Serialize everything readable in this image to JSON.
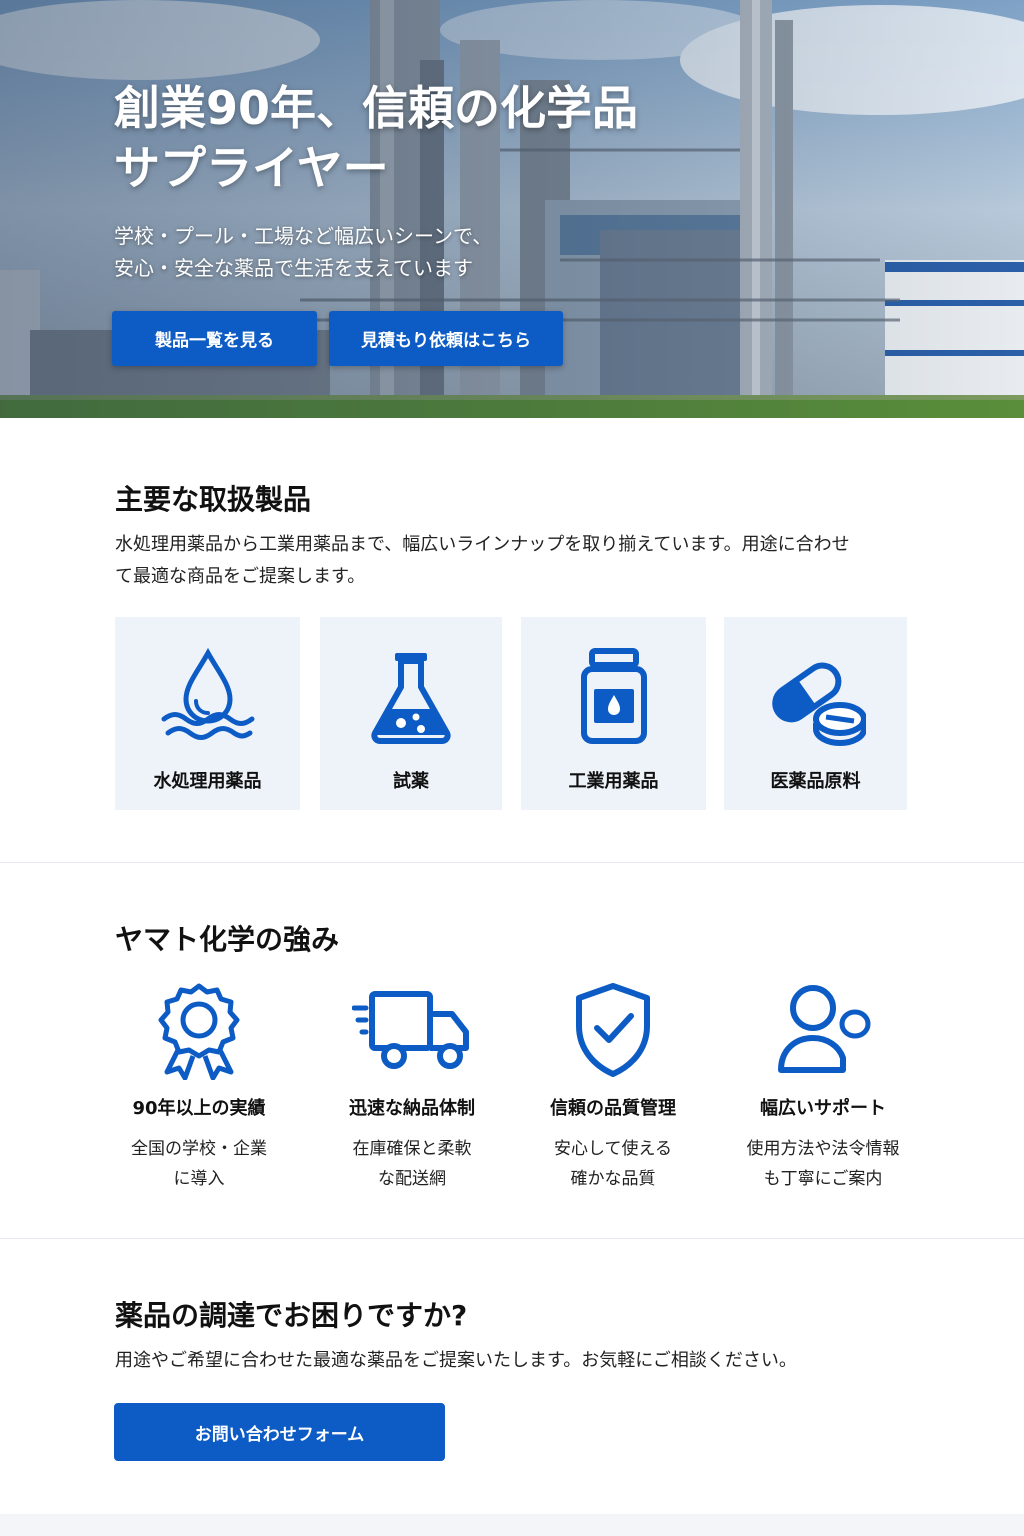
{
  "hero": {
    "title_line1": "創業90年、信頼の化学品",
    "title_line2": "サプライヤー",
    "subtitle_line1": "学校・プール・工場など幅広いシーンで、",
    "subtitle_line2": "安心・安全な薬品で生活を支えています",
    "btn_products": "製品一覧を見る",
    "btn_contact": "見積もり依頼はこちら"
  },
  "products": {
    "title": "主要な取扱製品",
    "description_line1": "水処理用薬品から工業用薬品まで、幅広いラインナップを取り揃えています。用途に合わせ",
    "description_line2": "て最適な商品をご提案します。",
    "items": [
      {
        "label": "水処理用薬品",
        "icon": "water-drop-icon"
      },
      {
        "label": "試薬",
        "icon": "flask-icon"
      },
      {
        "label": "工業用薬品",
        "icon": "bottle-icon"
      },
      {
        "label": "医薬品原料",
        "icon": "capsule-pill-icon"
      }
    ]
  },
  "strengths": {
    "title": "ヤマト化学の強み",
    "items": [
      {
        "title": "90年以上の実績",
        "desc_line1": "全国の学校・企業",
        "desc_line2": "に導入",
        "icon": "award-ribbon-icon"
      },
      {
        "title": "迅速な納品体制",
        "desc_line1": "在庫確保と柔軟",
        "desc_line2": "な配送網",
        "icon": "delivery-truck-icon"
      },
      {
        "title": "信頼の品質管理",
        "desc_line1": "安心して使える",
        "desc_line2": "確かな品質",
        "icon": "shield-check-icon"
      },
      {
        "title": "幅広いサポート",
        "desc_line1": "使用方法や法令情報",
        "desc_line2": "も丁寧にご案内",
        "icon": "support-person-icon"
      }
    ]
  },
  "cta": {
    "title": "薬品の調達でお困りですか?",
    "text": "用途やご希望に合わせた最適な薬品をご提案いたします。お気軽にご相談ください。",
    "button": "お問い合わせフォーム"
  },
  "colors": {
    "brand_blue": "#0d5bc4",
    "card_bg": "#eef3fa"
  }
}
